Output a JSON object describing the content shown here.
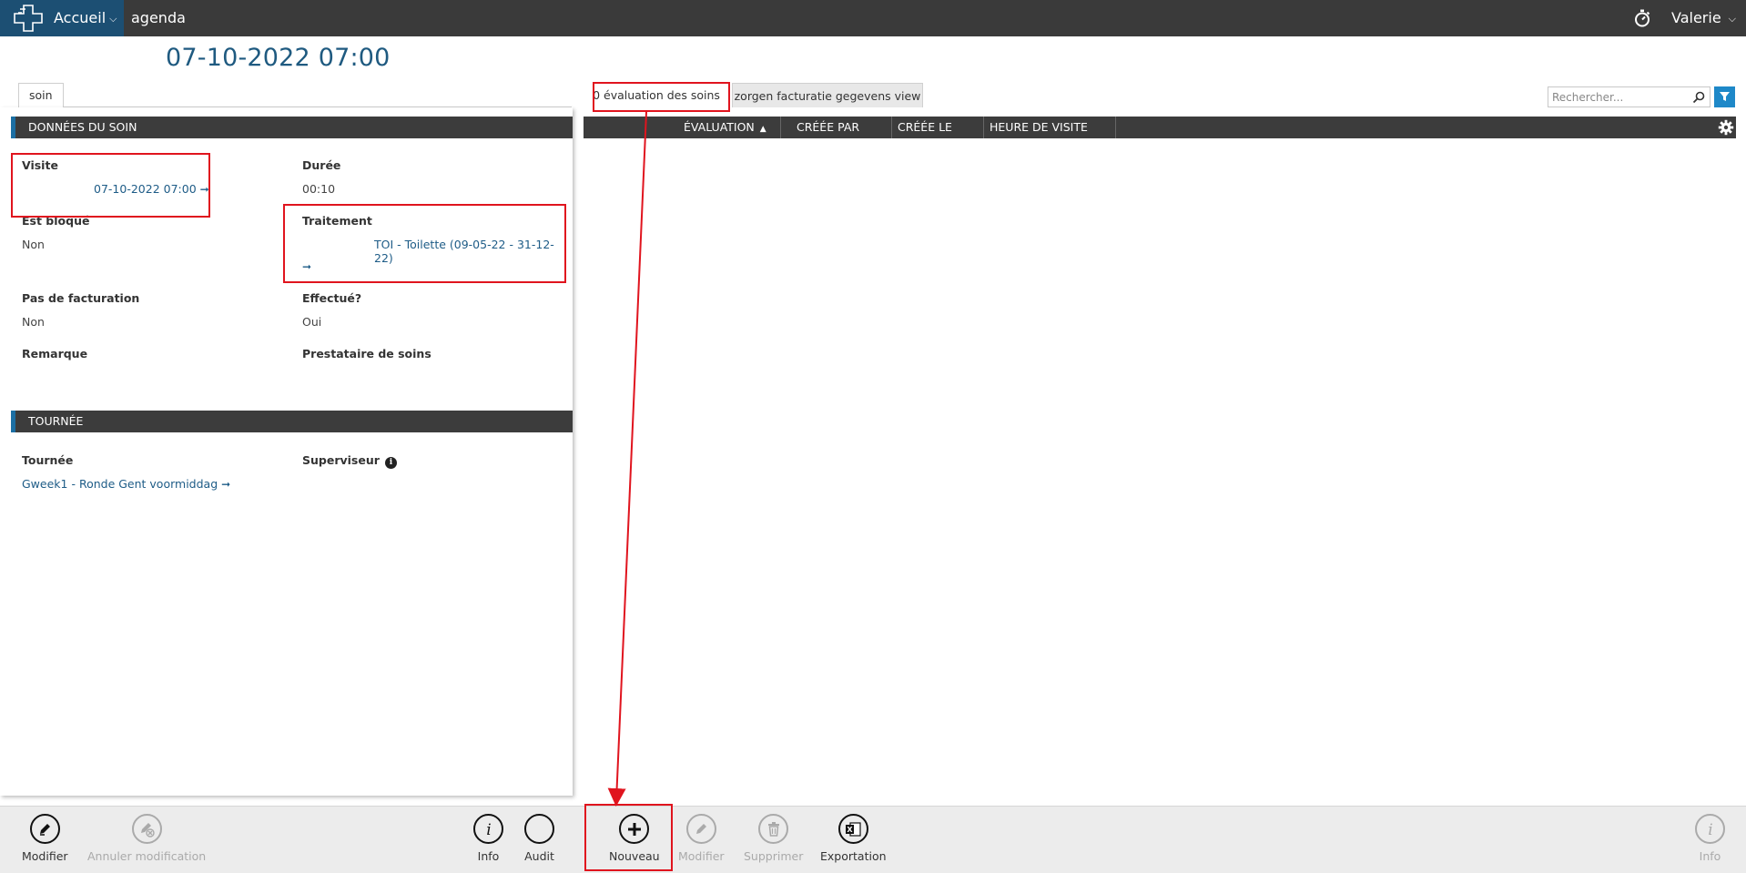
{
  "topbar": {
    "home_label": "Accueil",
    "breadcrumb": "agenda",
    "user_name": "Valerie"
  },
  "page": {
    "title": "07-10-2022 07:00"
  },
  "left": {
    "tab_label": "soin",
    "section_care": "DONNÉES DU SOIN",
    "visite_label": "Visite",
    "visite_value": "07-10-2022 07:00",
    "duree_label": "Durée",
    "duree_value": "00:10",
    "bloque_label": "Est bloqué",
    "bloque_value": "Non",
    "traitement_label": "Traitement",
    "traitement_value": "TOI - Toilette (09-05-22 - 31-12-22)",
    "facturation_label": "Pas de facturation",
    "facturation_value": "Non",
    "effectue_label": "Effectué?",
    "effectue_value": "Oui",
    "remarque_label": "Remarque",
    "prestataire_label": "Prestataire de soins",
    "section_tour": "TOURNÉE",
    "tournee_label": "Tournée",
    "tournee_value": "Gweek1 - Ronde Gent voormiddag",
    "superviseur_label": "Superviseur"
  },
  "right": {
    "tab1": "0 évaluation des soins",
    "tab2": "zorgen facturatie gegevens view",
    "search_placeholder": "Rechercher...",
    "columns": [
      "ÉVALUATION",
      "CRÉÉE PAR",
      "CRÉÉE LE",
      "HEURE DE VISITE"
    ]
  },
  "toolbar": {
    "modifier": "Modifier",
    "annuler": "Annuler modification",
    "info": "Info",
    "audit": "Audit",
    "nouveau": "Nouveau",
    "modifier2": "Modifier",
    "supprimer": "Supprimer",
    "exportation": "Exportation",
    "info2": "Info"
  },
  "colors": {
    "accent": "#1e88c8",
    "title": "#1f5a80",
    "annotation": "#e0141e"
  }
}
